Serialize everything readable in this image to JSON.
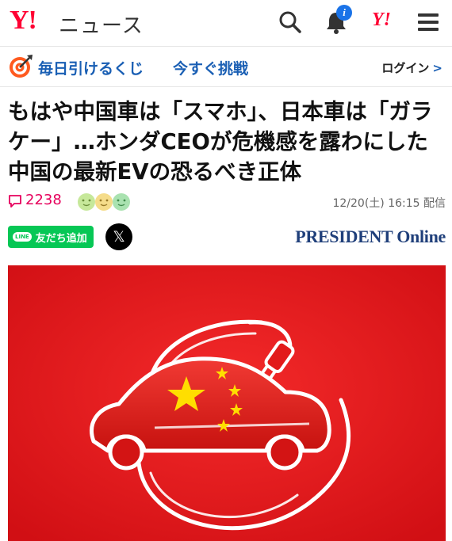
{
  "header": {
    "logo": "Y!",
    "section": "ニュース",
    "icons": [
      "search-icon",
      "bell-icon",
      "yahoo-icon",
      "menu-icon"
    ],
    "notification_badge": "i",
    "yahoo_short": "Y!"
  },
  "promo": {
    "icon": "target-icon",
    "title": "毎日引けるくじ",
    "cta": "今すぐ挑戦",
    "login": "ログイン",
    "login_chevron": ">"
  },
  "article": {
    "headline": "もはや中国車は「スマホ」、日本車は「ガラケー」…ホンダCEOが危機感を露わにした中国の最新EVの恐るべき正体",
    "comments_count": "2238",
    "date": "12/20(土) 16:15 配信",
    "line_label": "友だち追加",
    "line_badge": "LINE",
    "x_label": "𝕏",
    "publisher": "PRESIDENT Online"
  },
  "colors": {
    "brand_red": "#ff0033",
    "link_blue": "#1a5fb4",
    "comment_pink": "#e6005c",
    "line_green": "#06c755",
    "publisher_navy": "#1f3f7a",
    "hero_red": "#e8161b"
  }
}
